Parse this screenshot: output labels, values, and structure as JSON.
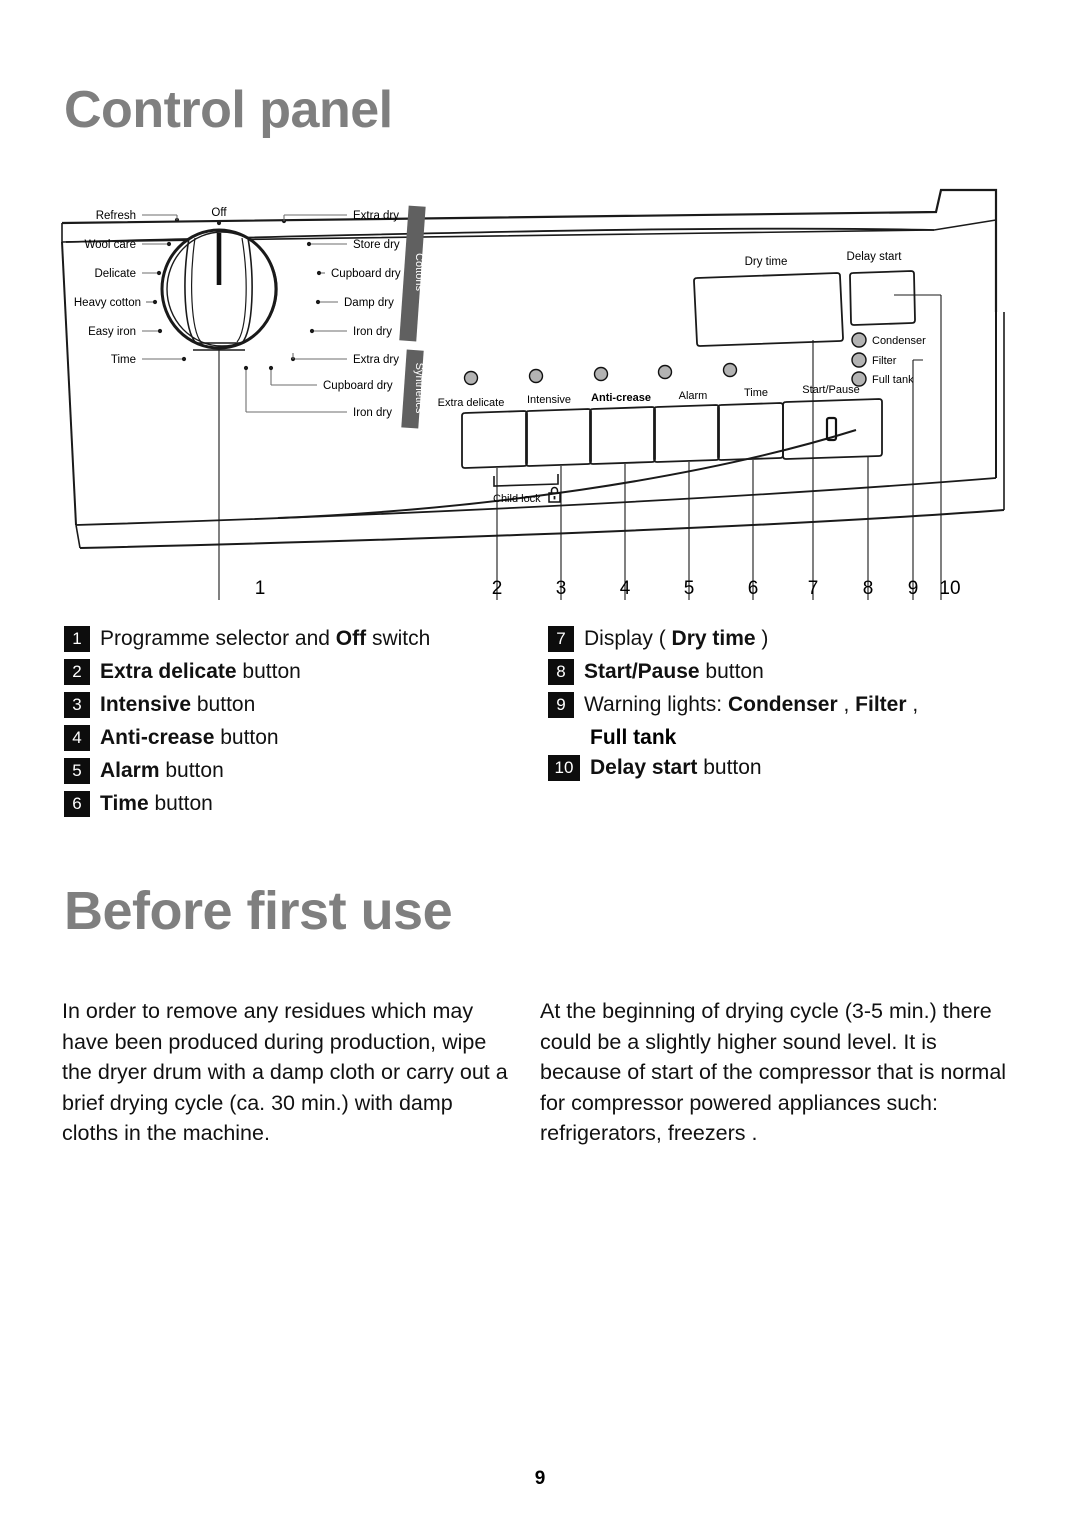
{
  "headings": {
    "control_panel": "Control panel",
    "before_first_use": "Before first use"
  },
  "panel_diagram": {
    "knob": {
      "center_label": "Off",
      "left_positions": [
        "Refresh",
        "Wool care",
        "Delicate",
        "Heavy cotton",
        "Easy iron",
        "Time"
      ],
      "right_positions_cottons": [
        "Extra dry",
        "Store dry",
        "Cupboard dry",
        "Damp dry",
        "Iron dry"
      ],
      "right_positions_synthetics": [
        "Extra dry",
        "Cupboard dry",
        "Iron dry"
      ],
      "category_cottons": "Cottons",
      "category_synthetics": "Synthetics"
    },
    "buttons": [
      "Extra delicate",
      "Intensive",
      "Anti-crease",
      "Alarm",
      "Time",
      "Start/Pause"
    ],
    "child_lock_label": "Child lock",
    "child_lock_icon": "padlock-icon",
    "display_label": "Dry time",
    "delay_start_label": "Delay start",
    "warning_lights": [
      "Condenser",
      "Filter",
      "Full tank"
    ],
    "callout_numbers": [
      "1",
      "2",
      "3",
      "4",
      "5",
      "6",
      "7",
      "8",
      "9",
      "10"
    ]
  },
  "legend": {
    "left": [
      {
        "num": "1",
        "pre": "Programme selector and ",
        "bold": "Off",
        "post": " switch"
      },
      {
        "num": "2",
        "pre": "",
        "bold": "Extra delicate",
        "post": " button"
      },
      {
        "num": "3",
        "pre": "",
        "bold": "Intensive",
        "post": " button"
      },
      {
        "num": "4",
        "pre": "",
        "bold": "Anti-crease",
        "post": " button"
      },
      {
        "num": "5",
        "pre": "",
        "bold": "Alarm",
        "post": " button"
      },
      {
        "num": "6",
        "pre": "",
        "bold": "Time",
        "post": " button"
      }
    ],
    "right": [
      {
        "num": "7",
        "pre": "Display ( ",
        "bold": "Dry time",
        "post": " )"
      },
      {
        "num": "8",
        "pre": "",
        "bold": "Start/Pause",
        "post": " button"
      },
      {
        "num": "9",
        "pre": "Warning lights: ",
        "bold": "Condenser",
        "post": " , ",
        "bold2": "Filter",
        "post2": " ,",
        "continuation": "Full tank"
      },
      {
        "num": "10",
        "pre": "",
        "bold": "Delay start",
        "post": " button"
      }
    ]
  },
  "body": {
    "left": "In order to remove any residues which may have been produced during production, wipe the dryer drum with a damp cloth or carry out a brief drying cycle (ca. 30 min.) with damp cloths in the machine.",
    "right": "At the beginning of drying cycle (3-5 min.) there could be a slightly higher sound level. It is because of start of the compressor that is normal for compressor powered appliances such: refrigerators, freezers ."
  },
  "page_number": "9",
  "colors": {
    "heading_gray": "#7f7f7f",
    "band_gray": "#606060",
    "led_gray": "#b3b3b3",
    "ink": "#1a1a1a"
  }
}
